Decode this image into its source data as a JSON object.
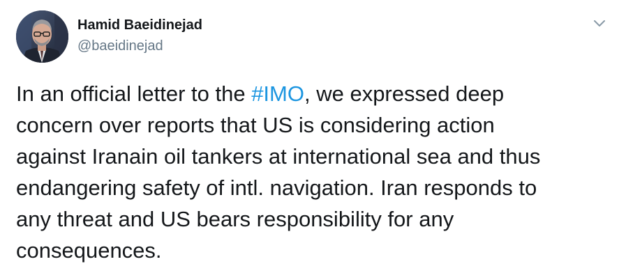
{
  "author": {
    "name": "Hamid Baeidinejad",
    "handle": "@baeidinejad",
    "avatar_icon": "profile-photo"
  },
  "menu": {
    "icon": "chevron-down-icon"
  },
  "tweet": {
    "line1_before": "In an official letter to the ",
    "hashtag": "#IMO",
    "line1_after": ", we expressed deep",
    "line2": "concern over reports that US is considering action",
    "line3": "against Iranain oil tankers at international sea and thus",
    "line4": "endangering safety of intl. navigation. Iran responds to",
    "line5": "any threat and US bears responsibility for any",
    "line6": "consequences."
  },
  "colors": {
    "link": "#1b95e0",
    "handle": "#657786",
    "text": "#14171a"
  }
}
